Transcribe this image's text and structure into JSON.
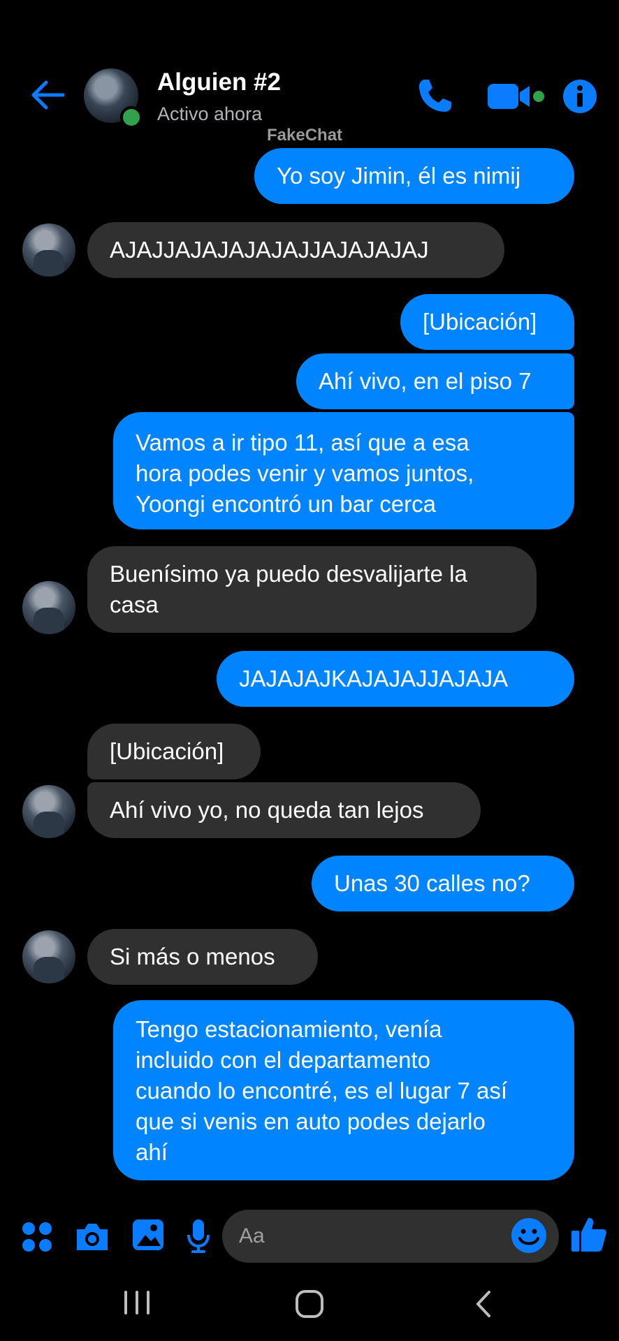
{
  "header": {
    "contact_name": "Alguien #2",
    "status": "Activo ahora",
    "watermark": "FakeChat"
  },
  "colors": {
    "accent": "#0084ff",
    "received_bubble": "#303030",
    "online": "#31a24c",
    "background": "#000000"
  },
  "icons": [
    "back-arrow-icon",
    "phone-icon",
    "video-camera-icon",
    "info-icon",
    "apps-icon",
    "camera-icon",
    "gallery-icon",
    "microphone-icon",
    "emoji-icon",
    "thumbs-up-icon"
  ],
  "messages": [
    {
      "from": "me",
      "text": "Yo soy Jimin, él es nimij"
    },
    {
      "from": "them",
      "text": "AJAJJAJAJAJAJAJJAJAJAJAJ"
    },
    {
      "from": "me",
      "text": "[Ubicación]"
    },
    {
      "from": "me",
      "text": "Ahí vivo, en el piso 7"
    },
    {
      "from": "me",
      "lines": [
        "Vamos a ir tipo 11, así que a esa",
        "hora podes venir y vamos juntos,",
        "Yoongi encontró un bar cerca"
      ]
    },
    {
      "from": "them",
      "lines": [
        "Buenísimo ya puedo desvalijarte la",
        "casa"
      ]
    },
    {
      "from": "me",
      "text": "JAJAJAJKAJAJAJJAJAJA"
    },
    {
      "from": "them",
      "text": "[Ubicación]"
    },
    {
      "from": "them",
      "text": "Ahí vivo yo, no queda tan lejos"
    },
    {
      "from": "me",
      "text": "Unas 30 calles no?"
    },
    {
      "from": "them",
      "text": "Si más o menos"
    },
    {
      "from": "me",
      "lines": [
        "Tengo estacionamiento, venía",
        "incluido con el departamento",
        "cuando lo encontré, es el lugar 7 así",
        "que si venis en auto podes dejarlo",
        "ahí"
      ]
    }
  ],
  "composer": {
    "placeholder": "Aa"
  },
  "navigation": [
    "recent-apps",
    "home",
    "back"
  ]
}
